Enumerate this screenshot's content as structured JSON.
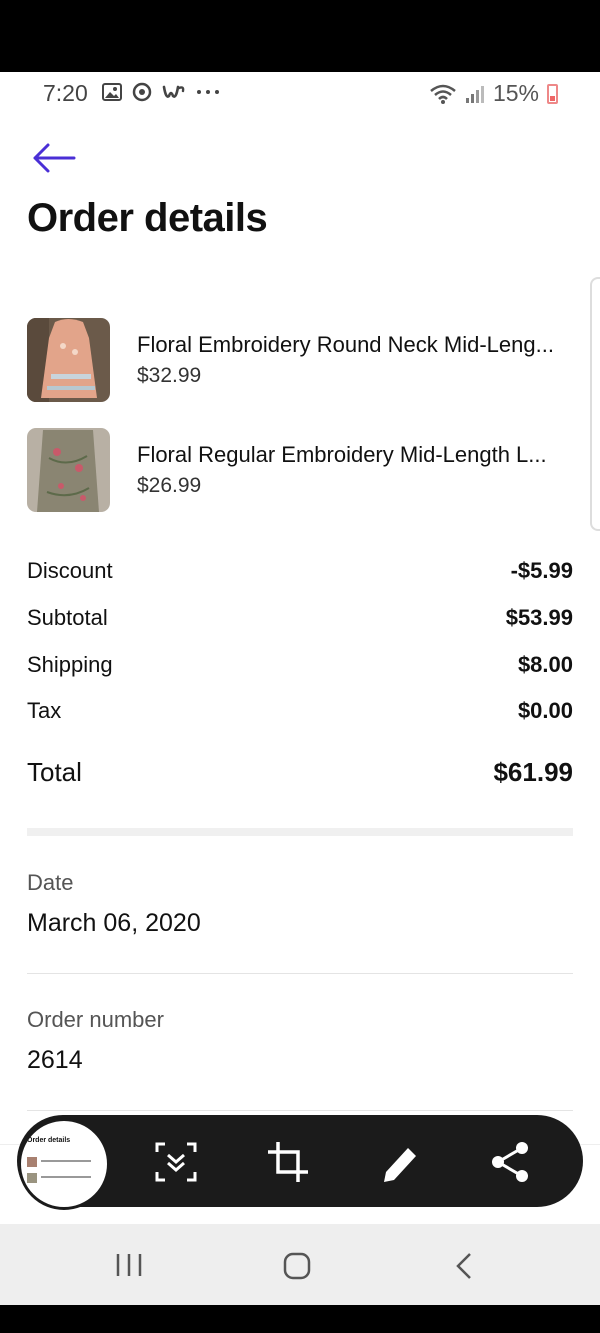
{
  "status": {
    "time": "7:20",
    "battery": "15%"
  },
  "page": {
    "title": "Order details"
  },
  "items": [
    {
      "name": "Floral Embroidery Round Neck Mid-Leng...",
      "price": "$32.99"
    },
    {
      "name": "Floral Regular Embroidery Mid-Length L...",
      "price": "$26.99"
    }
  ],
  "summary": {
    "discount": {
      "label": "Discount",
      "value": "-$5.99"
    },
    "subtotal": {
      "label": "Subtotal",
      "value": "$53.99"
    },
    "shipping": {
      "label": "Shipping",
      "value": "$8.00"
    },
    "tax": {
      "label": "Tax",
      "value": "$0.00"
    },
    "total": {
      "label": "Total",
      "value": "$61.99"
    }
  },
  "date": {
    "label": "Date",
    "value": "March 06, 2020"
  },
  "order_number": {
    "label": "Order number",
    "value": "2614"
  },
  "screenshot_toolbar": {
    "preview_title": "Order details",
    "tools": [
      "scroll-capture-icon",
      "crop-icon",
      "draw-icon",
      "share-icon"
    ]
  },
  "colors": {
    "accent": "#4a2fd6",
    "toolbar": "#1b1b1b"
  }
}
